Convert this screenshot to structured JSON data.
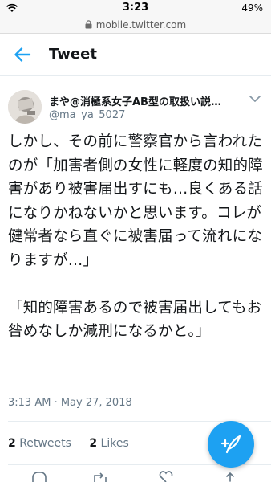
{
  "status_bar": {
    "time": "3:23",
    "battery": "49%"
  },
  "url_bar": {
    "url": "mobile.twitter.com"
  },
  "header": {
    "title": "Tweet"
  },
  "author": {
    "display_name": "まや@消極系女子AB型の取扱い説…",
    "handle": "@ma_ya_5027"
  },
  "tweet": {
    "text": "しかし、その前に警察官から言われたのが「加害者側の女性に軽度の知的障害があり被害届出すにも…良くある話になりかねないかと思います。コレが健常者なら直ぐに被害届って流れになりますが…」\n\n「知的障害あるので被害届出してもお咎めなしか減刑になるかと。」",
    "timestamp": "3:13 AM · May 27, 2018"
  },
  "stats": {
    "retweets_count": "2",
    "retweets_label": "Retweets",
    "likes_count": "2",
    "likes_label": "Likes"
  },
  "colors": {
    "accent": "#1da1f2",
    "muted": "#657786",
    "text": "#14171a"
  },
  "icons": [
    "wifi-icon",
    "lock-icon",
    "back-arrow-icon",
    "chevron-down-icon",
    "compose-tweet-icon",
    "reply-icon",
    "retweet-icon",
    "like-icon",
    "share-icon"
  ]
}
